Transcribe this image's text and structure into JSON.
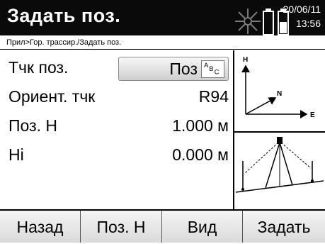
{
  "header": {
    "title": "Задать поз.",
    "date": "20/06/11",
    "time": "13:56",
    "icons": [
      "laser-sun-icon",
      "battery-1-icon",
      "battery-2-icon"
    ]
  },
  "breadcrumb": "Прил>Гор. трассир./Задать поз.",
  "fields": [
    {
      "label": "Тчк поз.",
      "value": "Поз",
      "input_mode": "ABC"
    },
    {
      "label": "Ориент. тчк",
      "value": "R94"
    },
    {
      "label": "Поз. Н",
      "value": "1.000 м"
    },
    {
      "label": "Hi",
      "value": "0.000 м"
    }
  ],
  "diagram": {
    "axis_h": "H",
    "axis_n": "N",
    "axis_e": "E"
  },
  "softkeys": [
    "Назад",
    "Поз. Н",
    "Вид",
    "Задать"
  ]
}
